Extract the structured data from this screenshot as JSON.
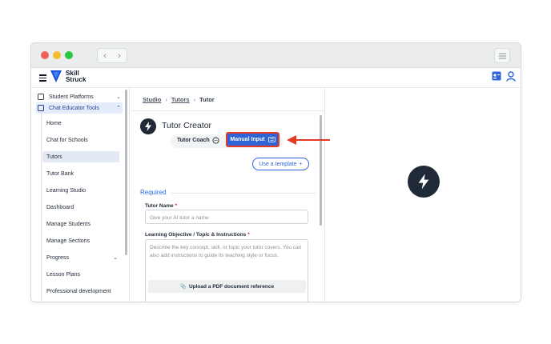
{
  "app": {
    "logo_line1": "Skill",
    "logo_line2": "Struck"
  },
  "sidebar": {
    "groups": [
      {
        "label": "Student Platforms",
        "icon": "window-icon",
        "expanded": false
      },
      {
        "label": "Chat Educator Tools",
        "icon": "chat-bolt-icon",
        "expanded": true
      }
    ],
    "items": [
      {
        "label": "Home"
      },
      {
        "label": "Chat for Schools"
      },
      {
        "label": "Tutors",
        "selected": true
      },
      {
        "label": "Tutor Bank"
      },
      {
        "label": "Learning Studio"
      },
      {
        "label": "Dashboard"
      },
      {
        "label": "Manage Students"
      },
      {
        "label": "Manage Sections"
      },
      {
        "label": "Progress",
        "has_children": true
      },
      {
        "label": "Lesson Plans"
      },
      {
        "label": "Professional development"
      }
    ]
  },
  "breadcrumb": {
    "items": [
      "Studio",
      "Tutors",
      "Tutor"
    ]
  },
  "creator": {
    "title": "Tutor Creator",
    "tab_coach": "Tutor Coach",
    "tab_manual": "Manual Input",
    "template_button": "Use a template",
    "section_required": "Required",
    "name_label": "Tutor Name",
    "name_placeholder": "Give your AI tutor a name",
    "objective_label": "Learning Objective / Topic & Instructions",
    "objective_placeholder": "Describe the key concept, skill, or topic your tutor covers. You can also add instructions to guide its teaching style or focus.",
    "upload_button": "Upload a PDF document reference",
    "required_marker": "*"
  },
  "colors": {
    "accent": "#2f64d8",
    "highlight": "#e43a26",
    "dark": "#1f2937"
  }
}
